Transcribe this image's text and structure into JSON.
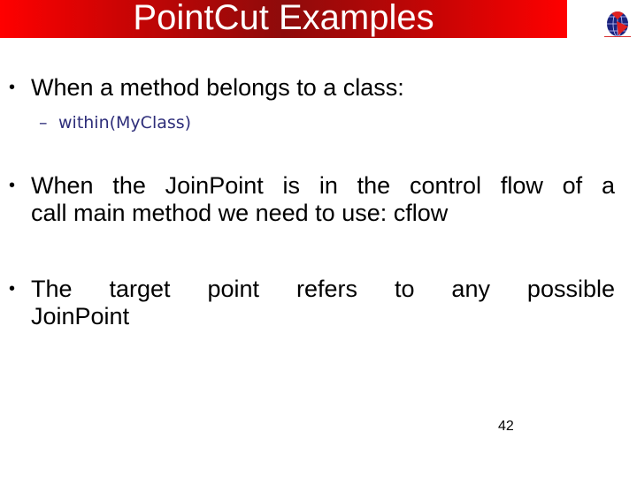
{
  "slide": {
    "title": "PointCut Examples",
    "logo_icon": "globe-logo-icon",
    "colors": {
      "banner_edge": "#ff0000",
      "banner_center": "#8e0b0b",
      "title_text": "#ffffff",
      "sub_bullet_text": "#2e2e7a"
    },
    "bullets": [
      {
        "marker": "•",
        "text": "When a method belongs to a class:",
        "sub_bullets": [
          {
            "marker": "–",
            "text": "within(MyClass)"
          }
        ]
      },
      {
        "marker": "•",
        "line1": "When the JoinPoint is in the control flow of a",
        "line2": "call main method we need to use: cflow"
      },
      {
        "marker": "•",
        "line1": "The target point refers to any possible",
        "line2": "JoinPoint"
      }
    ],
    "page_number": "42"
  }
}
